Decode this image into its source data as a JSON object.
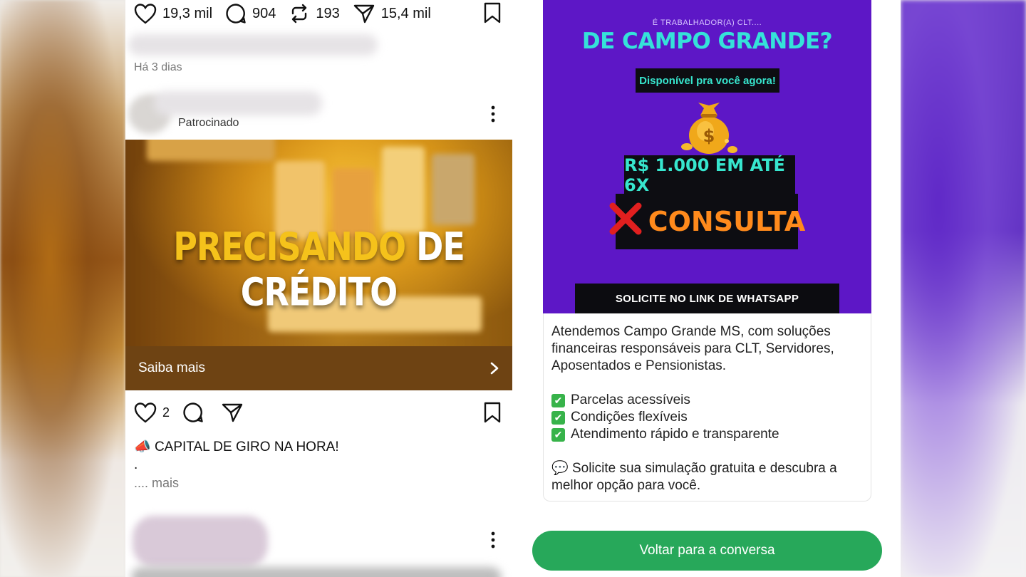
{
  "post1": {
    "likes": "19,3 mil",
    "comments": "904",
    "reposts": "193",
    "shares": "15,4 mil",
    "time_ago": "Há 3 dias"
  },
  "ad_post": {
    "sponsored_label": "Patrocinado",
    "image_title_part1": "PRECISANDO",
    "image_title_part2": "DE CRÉDITO",
    "cta_label": "Saiba mais",
    "likes": "2",
    "caption_emoji": "📣",
    "caption": "CAPITAL DE GIRO NA HORA!",
    "caption_line2": ".",
    "more_link": ".... mais"
  },
  "promo": {
    "subheading": "É TRABALHADOR(A) CLT....",
    "heading": "DE CAMPO GRANDE?",
    "pill": "Disponível pra você agora!",
    "amount": "R$ 1.000 EM ATÉ 6X",
    "consulta": "CONSULTA",
    "footer": "SOLICITE NO LINK DE WHATSAPP"
  },
  "message": {
    "intro": "Atendemos Campo Grande MS, com soluções financeiras responsáveis para CLT, Servidores, Aposentados e Pensionistas.",
    "bullets": [
      "Parcelas acessíveis",
      "Condições flexíveis",
      "Atendimento rápido e transparente"
    ],
    "closing_emoji": "💬",
    "closing": "Solicite sua simulação gratuita e descubra a melhor opção para você."
  },
  "back_button": "Voltar para a conversa",
  "colors": {
    "promo_purple": "#5d17c6",
    "promo_teal": "#35e2d9",
    "promo_orange": "#ff8a1c",
    "cta_brown": "#6e4313",
    "whatsapp_green": "#27a85a"
  }
}
